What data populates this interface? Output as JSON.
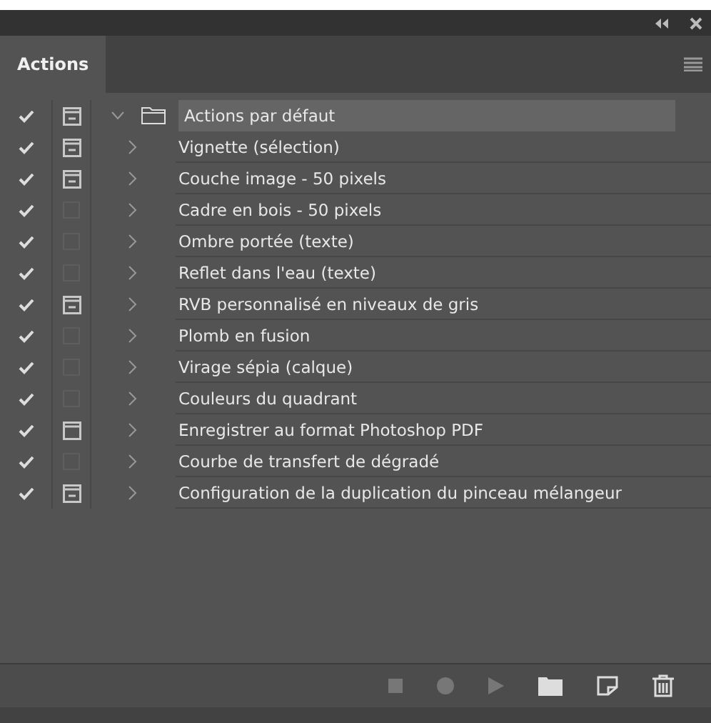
{
  "panel": {
    "tab": {
      "label": "Actions",
      "selected": true
    }
  },
  "actions": [
    {
      "kind": "set",
      "label": "Actions par défaut",
      "checked": true,
      "dialog": true,
      "dialog_partial": false,
      "expanded": true,
      "selected": true
    },
    {
      "kind": "action",
      "label": "Vignette (sélection)",
      "checked": true,
      "dialog": true,
      "dialog_partial": false,
      "expanded": false,
      "selected": false
    },
    {
      "kind": "action",
      "label": "Couche image - 50 pixels",
      "checked": true,
      "dialog": true,
      "dialog_partial": false,
      "expanded": false,
      "selected": false
    },
    {
      "kind": "action",
      "label": "Cadre en bois - 50 pixels",
      "checked": true,
      "dialog": false,
      "dialog_partial": false,
      "expanded": false,
      "selected": false
    },
    {
      "kind": "action",
      "label": "Ombre portée (texte)",
      "checked": true,
      "dialog": false,
      "dialog_partial": false,
      "expanded": false,
      "selected": false
    },
    {
      "kind": "action",
      "label": "Reflet dans l'eau (texte)",
      "checked": true,
      "dialog": false,
      "dialog_partial": false,
      "expanded": false,
      "selected": false
    },
    {
      "kind": "action",
      "label": "RVB personnalisé en niveaux de gris",
      "checked": true,
      "dialog": true,
      "dialog_partial": false,
      "expanded": false,
      "selected": false
    },
    {
      "kind": "action",
      "label": "Plomb en fusion",
      "checked": true,
      "dialog": false,
      "dialog_partial": false,
      "expanded": false,
      "selected": false
    },
    {
      "kind": "action",
      "label": "Virage sépia (calque)",
      "checked": true,
      "dialog": false,
      "dialog_partial": false,
      "expanded": false,
      "selected": false
    },
    {
      "kind": "action",
      "label": "Couleurs du quadrant",
      "checked": true,
      "dialog": false,
      "dialog_partial": false,
      "expanded": false,
      "selected": false
    },
    {
      "kind": "action",
      "label": "Enregistrer au format Photoshop PDF",
      "checked": true,
      "dialog": true,
      "dialog_partial": true,
      "expanded": false,
      "selected": false
    },
    {
      "kind": "action",
      "label": "Courbe de transfert de dégradé",
      "checked": true,
      "dialog": false,
      "dialog_partial": false,
      "expanded": false,
      "selected": false
    },
    {
      "kind": "action",
      "label": "Configuration de la duplication du pinceau mélangeur",
      "checked": true,
      "dialog": true,
      "dialog_partial": false,
      "expanded": false,
      "selected": false
    }
  ]
}
